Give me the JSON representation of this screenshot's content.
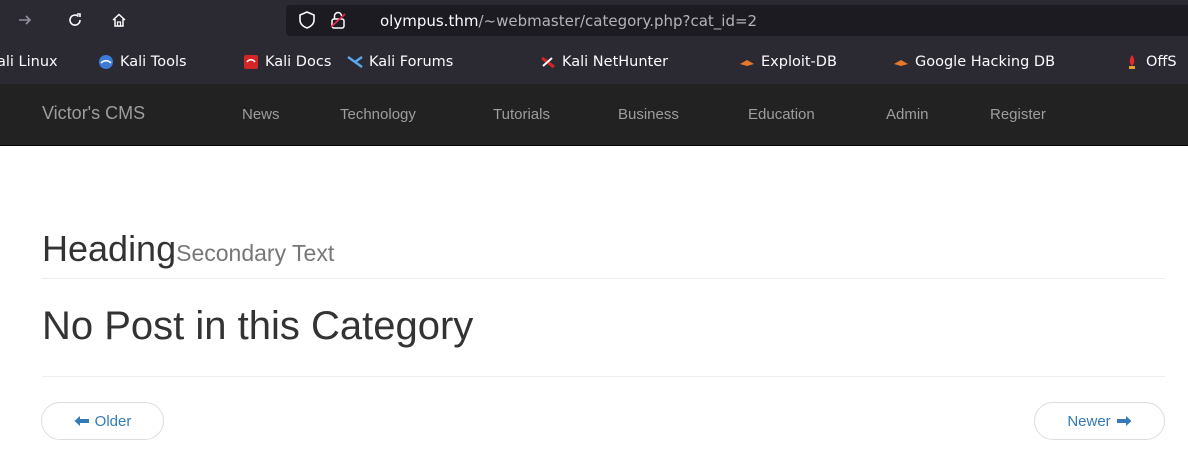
{
  "browser": {
    "url_host": "olympus.thm",
    "url_path": "/~webmaster/category.php?cat_id=2",
    "icons": [
      "forward-icon",
      "reload-icon",
      "home-icon",
      "shield-icon",
      "lock-icon"
    ]
  },
  "bookmarks": [
    {
      "label": "ali Linux",
      "icon": "kali-icon"
    },
    {
      "label": "Kali Tools",
      "icon": "kali-tools-icon"
    },
    {
      "label": "Kali Docs",
      "icon": "kali-docs-icon"
    },
    {
      "label": "Kali Forums",
      "icon": "kali-forums-icon"
    },
    {
      "label": "Kali NetHunter",
      "icon": "nethunter-icon"
    },
    {
      "label": "Exploit-DB",
      "icon": "exploit-db-icon"
    },
    {
      "label": "Google Hacking DB",
      "icon": "ghdb-icon"
    },
    {
      "label": "OffS",
      "icon": "offsec-icon"
    }
  ],
  "site_nav": {
    "brand": "Victor's CMS",
    "links": [
      "News",
      "Technology",
      "Tutorials",
      "Business",
      "Education",
      "Admin",
      "Register"
    ]
  },
  "content": {
    "heading": "Heading",
    "heading_secondary": "Secondary Text",
    "message": "No Post in this Category"
  },
  "pager": {
    "older_label": "Older",
    "newer_label": "Newer"
  },
  "colors": {
    "browser_chrome": "#2b2a33",
    "navbar_bg": "#222222",
    "link_blue": "#337ab7"
  }
}
